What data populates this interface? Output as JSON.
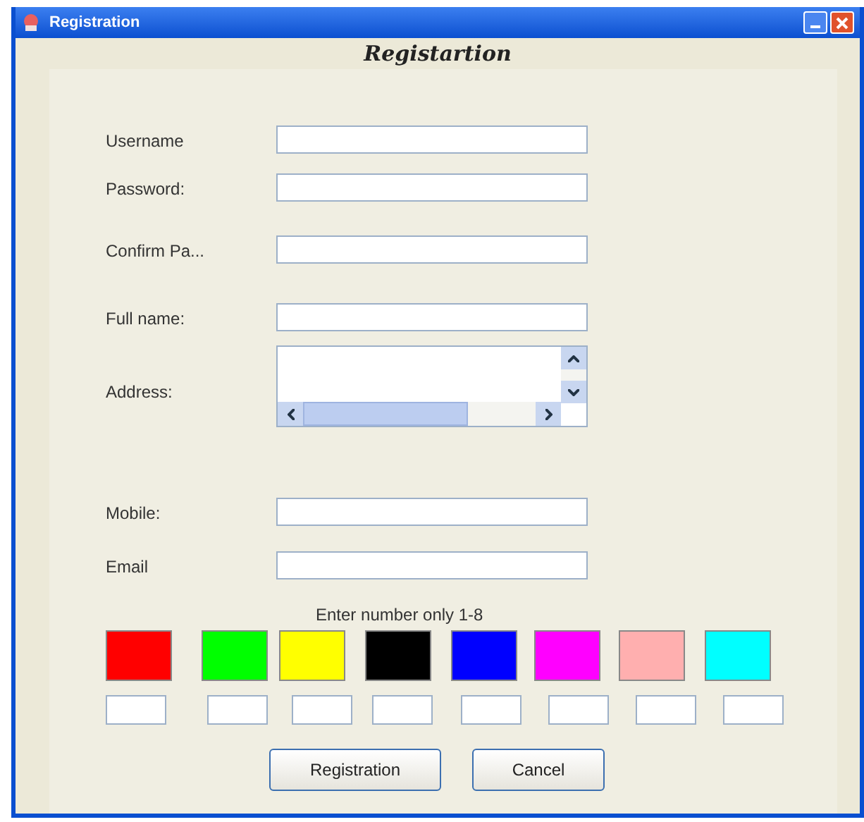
{
  "window": {
    "title": "Registration"
  },
  "heading": "Registartion",
  "fields": [
    {
      "label": "Username",
      "kind": "text"
    },
    {
      "label": "Password:",
      "kind": "text"
    },
    {
      "label": "Confirm Pa...",
      "kind": "text"
    },
    {
      "label": "Full name:",
      "kind": "text"
    },
    {
      "label": "Address:",
      "kind": "area"
    },
    {
      "label": "Mobile:",
      "kind": "text"
    },
    {
      "label": "Email",
      "kind": "text"
    }
  ],
  "hint": "Enter number only 1-8",
  "swatches": [
    {
      "color": "#ff0000"
    },
    {
      "color": "#00ff00"
    },
    {
      "color": "#ffff00"
    },
    {
      "color": "#000000"
    },
    {
      "color": "#0000ff"
    },
    {
      "color": "#ff00ff"
    },
    {
      "color": "#ffafaf"
    },
    {
      "color": "#00ffff"
    }
  ],
  "buttons": [
    "Registration",
    "Cancel"
  ]
}
